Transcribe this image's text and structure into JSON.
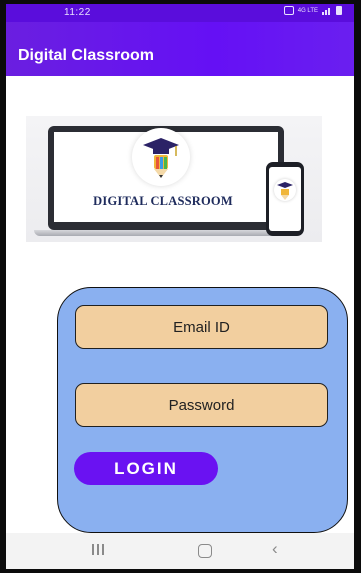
{
  "status_bar": {
    "time": "11:22",
    "network_label": "4G LTE"
  },
  "app_bar": {
    "title": "Digital Classroom"
  },
  "banner": {
    "logo_text": "DIGITAL CLASSROOM"
  },
  "login_form": {
    "email_placeholder": "Email ID",
    "password_placeholder": "Password",
    "login_label": "LOGIN"
  },
  "icons": {
    "alarm": "alarm-icon",
    "signal": "signal-icon",
    "battery": "battery-icon",
    "recents": "recents-icon",
    "home": "home-icon",
    "back": "back-icon"
  },
  "colors": {
    "app_bar": "#6510f5",
    "card": "#8ab0f0",
    "field": "#f2cf9f",
    "button": "#6a12f2"
  }
}
